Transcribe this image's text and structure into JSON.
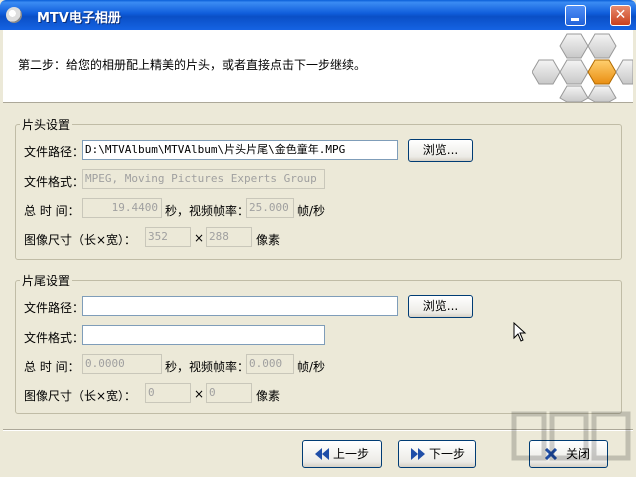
{
  "window": {
    "title": "MTV电子相册"
  },
  "banner": {
    "step_text": "第二步：给您的相册配上精美的片头，或者直接点击下一步继续。"
  },
  "header_group": {
    "title": "片头设置",
    "path_label": "文件路径：",
    "path_value": "D:\\MTVAlbum\\MTVAlbum\\片头片尾\\金色童年.MPG",
    "browse_label": "浏览...",
    "format_label": "文件格式：",
    "format_value": "MPEG, Moving Pictures Experts Group",
    "duration_label": "总 时 间：",
    "duration_value": "19.4400",
    "fps_label": "秒，视频帧率：",
    "fps_value": "25.000",
    "fps_unit": "帧/秒",
    "size_label": "图像尺寸（长×宽）：",
    "width_value": "352",
    "times": "×",
    "height_value": "288",
    "pixel_unit": "像素"
  },
  "footer_group": {
    "title": "片尾设置",
    "path_label": "文件路径：",
    "path_value": "",
    "browse_label": "浏览...",
    "format_label": "文件格式：",
    "format_value": "",
    "duration_label": "总 时 间：",
    "duration_value": "0.0000",
    "fps_label": "秒，视频帧率：",
    "fps_value": "0.000",
    "fps_unit": "帧/秒",
    "size_label": "图像尺寸（长×宽）：",
    "width_value": "0",
    "times": "×",
    "height_value": "0",
    "pixel_unit": "像素"
  },
  "nav": {
    "prev_label": "上一步",
    "next_label": "下一步",
    "close_label": "关闭"
  },
  "colors": {
    "titlebar": "#0a5fd8",
    "accent_hex": "#f5a623",
    "dialog_bg": "#ece9d8"
  }
}
